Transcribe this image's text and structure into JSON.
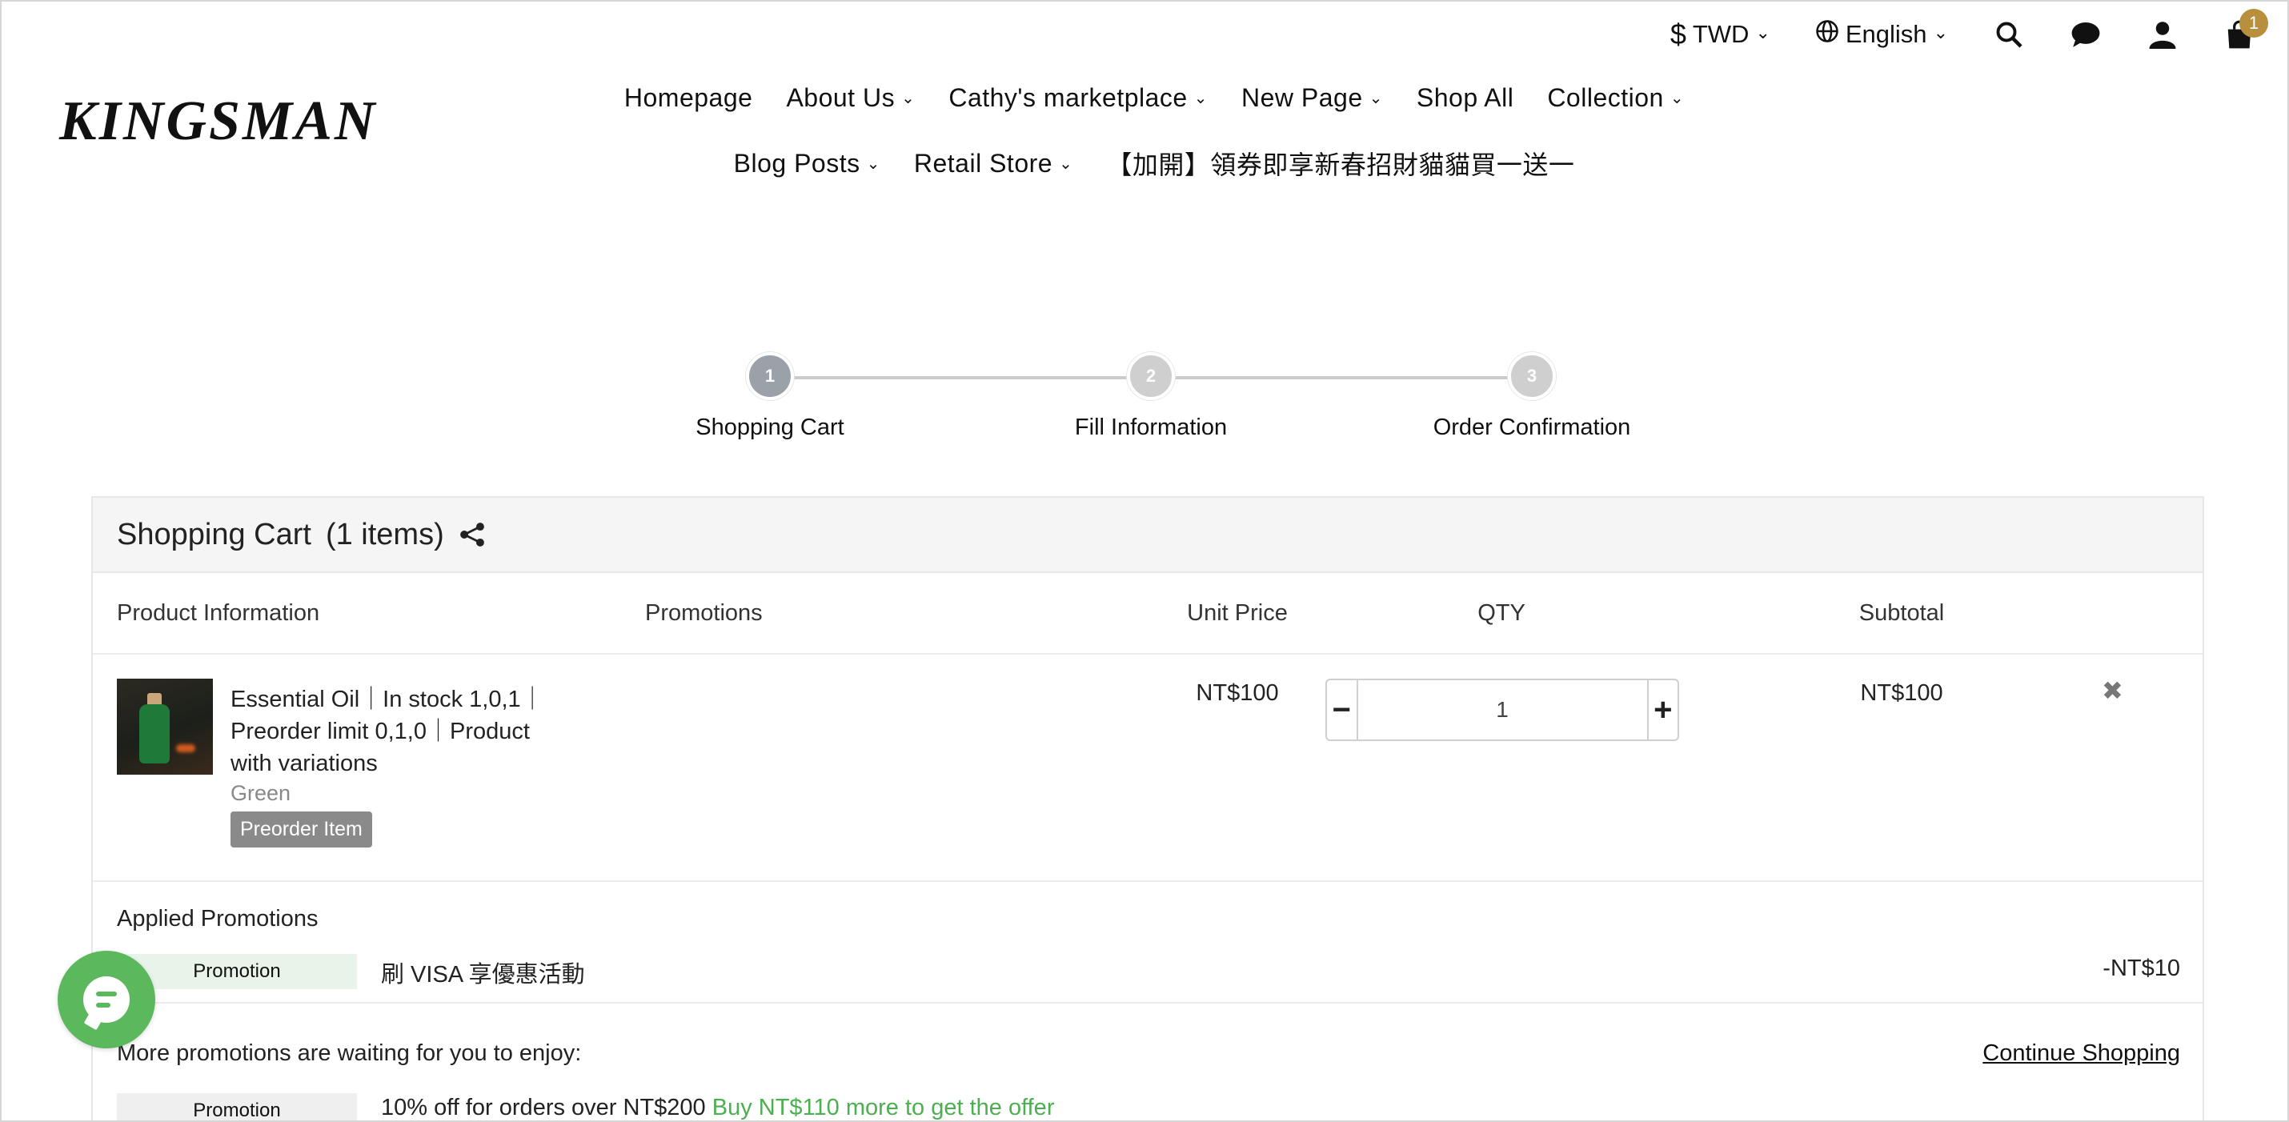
{
  "utility": {
    "currency_symbol": "$",
    "currency": "TWD",
    "language": "English",
    "cart_count": "1"
  },
  "logo": "KINGSMAN",
  "nav": {
    "items": [
      {
        "label": "Homepage",
        "dropdown": false
      },
      {
        "label": "About Us",
        "dropdown": true
      },
      {
        "label": "Cathy's marketplace",
        "dropdown": true
      },
      {
        "label": "New Page",
        "dropdown": true
      },
      {
        "label": "Shop All",
        "dropdown": false
      },
      {
        "label": "Collection",
        "dropdown": true
      },
      {
        "label": "Blog Posts",
        "dropdown": true
      },
      {
        "label": "Retail Store",
        "dropdown": true
      },
      {
        "label": "【加開】領券即享新春招財貓貓買一送一",
        "dropdown": false
      }
    ]
  },
  "stepper": {
    "steps": [
      {
        "num": "1",
        "label": "Shopping Cart",
        "active": true
      },
      {
        "num": "2",
        "label": "Fill Information",
        "active": false
      },
      {
        "num": "3",
        "label": "Order Confirmation",
        "active": false
      }
    ]
  },
  "cart": {
    "title": "Shopping Cart",
    "count_label": "(1 items)",
    "columns": {
      "product": "Product Information",
      "promotions": "Promotions",
      "unit_price": "Unit Price",
      "qty": "QTY",
      "subtotal": "Subtotal"
    },
    "item": {
      "name": "Essential Oil｜In stock 1,0,1｜Preorder limit 0,1,0｜Product with variations",
      "variant": "Green",
      "badge": "Preorder Item",
      "unit_price": "NT$100",
      "qty": "1",
      "subtotal": "NT$100",
      "remove": "✖"
    },
    "applied": {
      "title": "Applied Promotions",
      "tag": "Promotion",
      "name": "刷 VISA 享優惠活動",
      "discount": "-NT$10"
    },
    "more": {
      "title": "More promotions are waiting for you to enjoy:",
      "continue": "Continue Shopping",
      "tag": "Promotion",
      "offer": "10% off for orders over NT$200",
      "hint": "Buy NT$110 more to get the offer"
    }
  },
  "colors": {
    "accent_green": "#5cb85c",
    "badge_gold": "#b88f3d",
    "step_active": "#9aa1a8"
  }
}
